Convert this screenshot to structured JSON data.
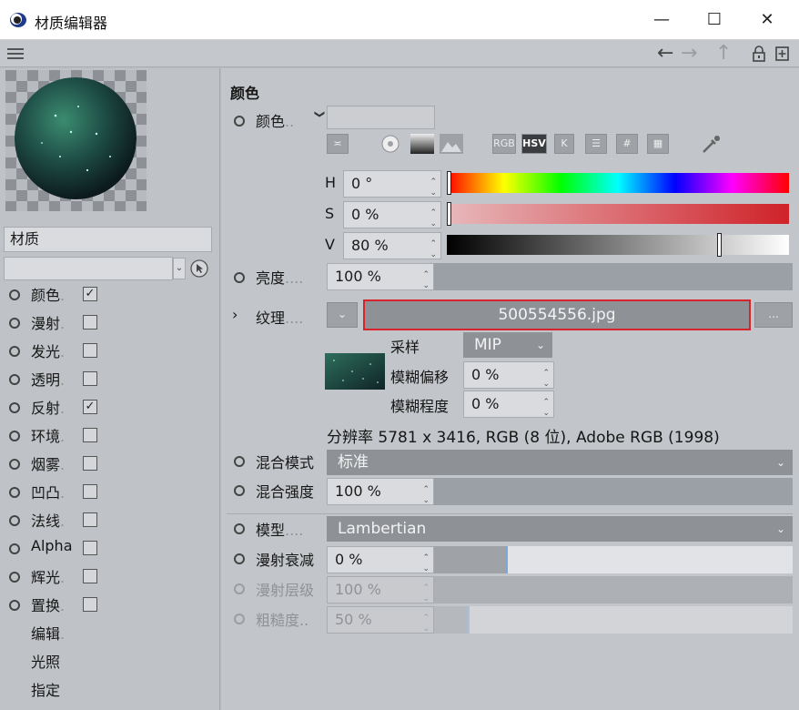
{
  "window": {
    "title": "材质编辑器",
    "minimize": "—",
    "maximize": "☐",
    "close": "✕"
  },
  "toolbar": {
    "menu_icon": "hamburger-icon",
    "back": "←",
    "forward": "→",
    "up": "↑"
  },
  "left": {
    "material_name": "材质",
    "channels": [
      {
        "label": "颜色",
        "dots": ".",
        "checked": true,
        "radio": true
      },
      {
        "label": "漫射",
        "dots": ".",
        "checked": false,
        "radio": true
      },
      {
        "label": "发光",
        "dots": ".",
        "checked": false,
        "radio": true
      },
      {
        "label": "透明",
        "dots": ".",
        "checked": false,
        "radio": true
      },
      {
        "label": "反射",
        "dots": ".",
        "checked": true,
        "radio": true
      },
      {
        "label": "环境",
        "dots": ".",
        "checked": false,
        "radio": true
      },
      {
        "label": "烟雾",
        "dots": ".",
        "checked": false,
        "radio": true
      },
      {
        "label": "凹凸",
        "dots": ".",
        "checked": false,
        "radio": true
      },
      {
        "label": "法线",
        "dots": ".",
        "checked": false,
        "radio": true
      },
      {
        "label": "Alpha",
        "dots": "",
        "checked": false,
        "radio": true
      },
      {
        "label": "辉光",
        "dots": ".",
        "checked": false,
        "radio": true
      },
      {
        "label": "置换",
        "dots": ".",
        "checked": false,
        "radio": true
      }
    ],
    "extras": [
      {
        "label": "编辑",
        "dots": "."
      },
      {
        "label": "光照",
        "dots": ""
      },
      {
        "label": "指定",
        "dots": ""
      }
    ]
  },
  "right": {
    "section_title": "颜色",
    "color_label": "颜色",
    "color_dots": "..",
    "color_caret": "❯",
    "tabs": [
      "RGB",
      "HSV",
      "K"
    ],
    "hsv": {
      "h_label": "H",
      "h_value": "0 °",
      "h_pos": 0.0,
      "s_label": "S",
      "s_value": "0 %",
      "s_pos": 0.0,
      "v_label": "V",
      "v_value": "80 %",
      "v_pos": 0.8
    },
    "brightness": {
      "label": "亮度",
      "dots": "....",
      "value": "100 %",
      "level": 1.0
    },
    "texture": {
      "caret": "›",
      "label": "纹理",
      "dots": "....",
      "file": "500554556.jpg",
      "more": "...",
      "sampling_label": "采样",
      "sampling_value": "MIP",
      "blur_offset_label": "模糊偏移",
      "blur_offset_value": "0 %",
      "blur_scale_label": "模糊程度",
      "blur_scale_value": "0 %",
      "resolution": "分辨率 5781 x 3416, RGB (8 位), Adobe RGB (1998)"
    },
    "mix_mode": {
      "label": "混合模式",
      "value": "标准"
    },
    "mix_strength": {
      "label": "混合强度",
      "value": "100 %",
      "level": 1.0
    },
    "model": {
      "label": "模型",
      "dots": "....",
      "value": "Lambertian"
    },
    "diffuse_falloff": {
      "label": "漫射衰减",
      "value": "0 %",
      "level": 0.5
    },
    "diffuse_level": {
      "label": "漫射层级",
      "value": "100 %",
      "level": 1.0
    },
    "roughness": {
      "label": "粗糙度",
      "dots": "..",
      "value": "50 %",
      "level": 0.25
    }
  },
  "colors": {
    "accent_red": "#d8232a",
    "panel": "#c2c5c9",
    "dropdown": "#8e9297"
  }
}
